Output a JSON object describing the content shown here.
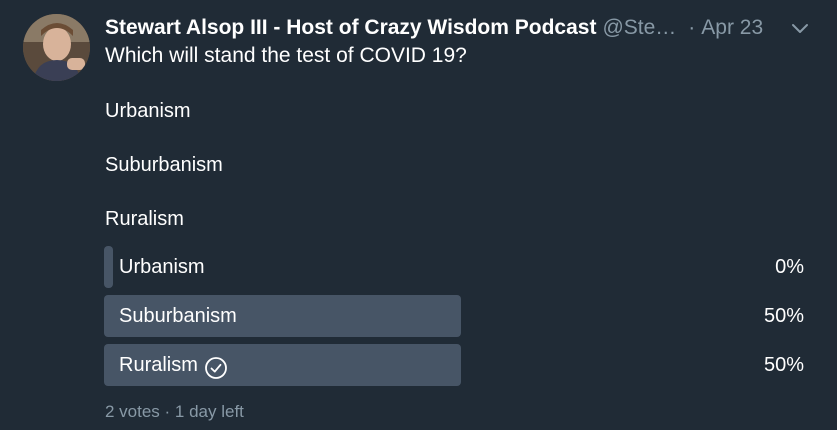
{
  "tweet": {
    "author_name": "Stewart Alsop III - Host of Crazy Wisdom Podcast",
    "handle": "@Ste…",
    "separator": "·",
    "date": "Apr 23",
    "text": "Which will stand the test of COVID 19?",
    "choices_text": [
      "Urbanism",
      "Suburbanism",
      "Ruralism"
    ]
  },
  "poll": {
    "options": [
      {
        "label": "Urbanism",
        "percent_text": "0%",
        "percent": 0,
        "winner": false
      },
      {
        "label": "Suburbanism",
        "percent_text": "50%",
        "percent": 50,
        "winner": false
      },
      {
        "label": "Ruralism",
        "percent_text": "50%",
        "percent": 50,
        "winner": true
      }
    ],
    "footer": "2 votes · 1 day left"
  },
  "colors": {
    "background": "#202b36",
    "bar": "#475566",
    "muted_text": "#8899a6"
  },
  "icons": [
    "avatar",
    "chevron-down-icon",
    "check-circle-icon"
  ]
}
